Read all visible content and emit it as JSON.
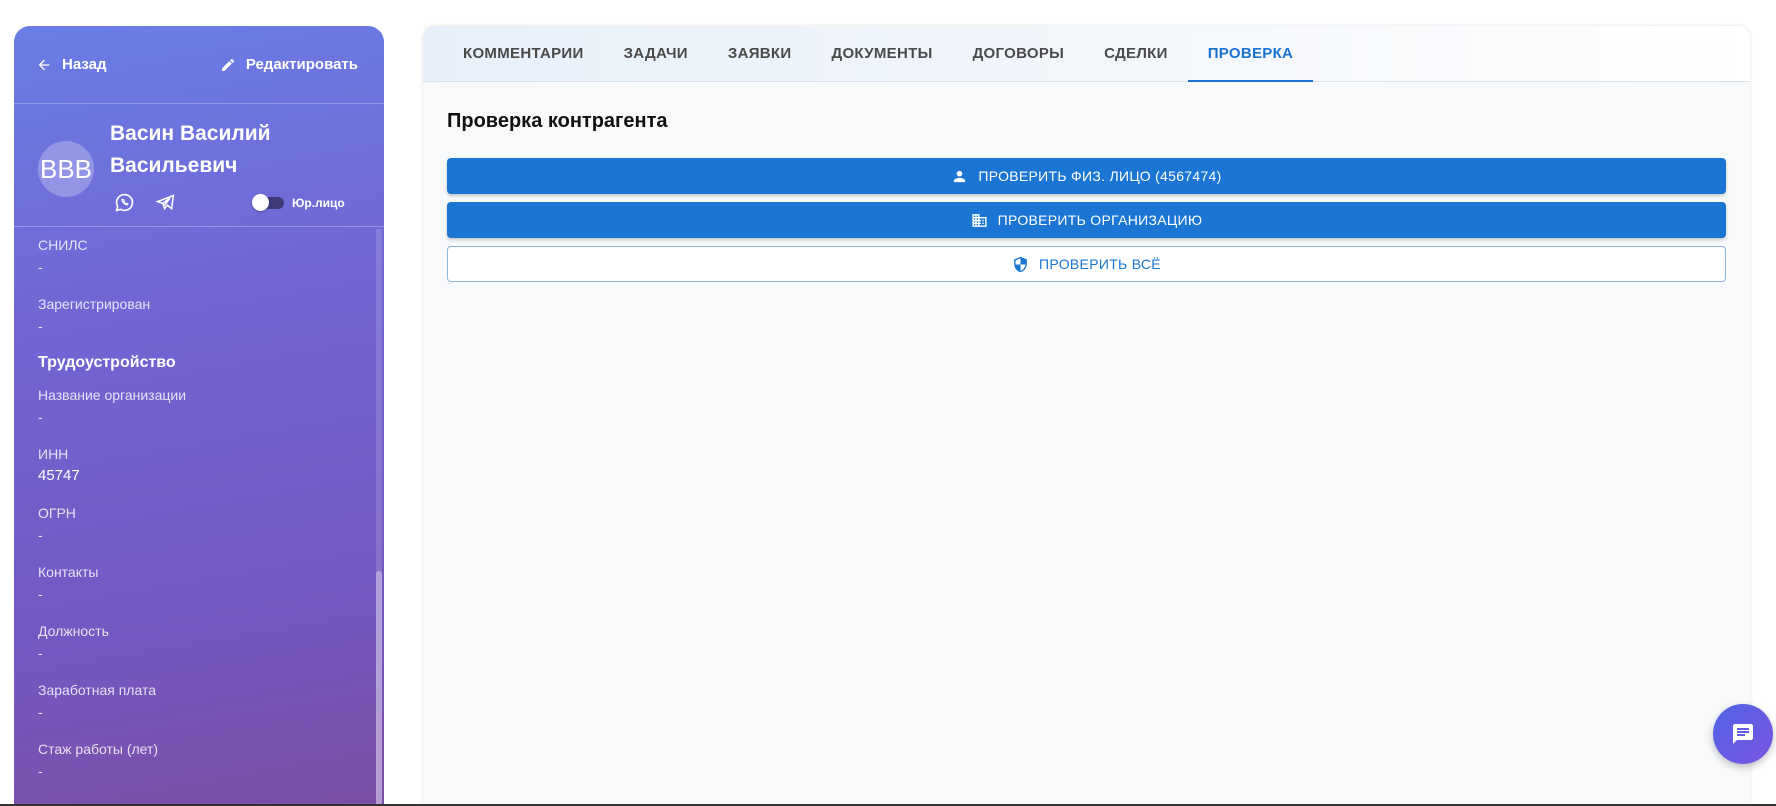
{
  "sidebar": {
    "back_label": "Назад",
    "edit_label": "Редактировать",
    "avatar_initials": "ВВВ",
    "name_line1": "Васин Василий",
    "name_line2": "Васильевич",
    "toggle_label": "Юр.лицо",
    "snils": {
      "label": "СНИЛС",
      "value": "-"
    },
    "registered": {
      "label": "Зарегистрирован",
      "value": "-"
    },
    "employment_title": "Трудоустройство",
    "employment": [
      {
        "label": "Название организации",
        "value": "-"
      },
      {
        "label": "ИНН",
        "value": "45747"
      },
      {
        "label": "ОГРН",
        "value": "-"
      },
      {
        "label": "Контакты",
        "value": "-"
      },
      {
        "label": "Должность",
        "value": "-"
      },
      {
        "label": "Заработная плата",
        "value": "-"
      },
      {
        "label": "Стаж работы (лет)",
        "value": "-"
      }
    ]
  },
  "tabs": [
    "КОММЕНТАРИИ",
    "ЗАДАЧИ",
    "ЗАЯВКИ",
    "ДОКУМЕНТЫ",
    "ДОГОВОРЫ",
    "СДЕЛКИ",
    "ПРОВЕРКА"
  ],
  "main": {
    "heading": "Проверка контрагента",
    "check_person_label": "ПРОВЕРИТЬ ФИЗ. ЛИЦО (4567474)",
    "check_org_label": "ПРОВЕРИТЬ ОРГАНИЗАЦИЮ",
    "check_all_label": "ПРОВЕРИТЬ ВСЁ"
  },
  "icons": {
    "back": "arrow-left-icon",
    "edit": "pencil-icon",
    "whatsapp": "whatsapp-icon",
    "telegram": "telegram-icon",
    "person": "person-icon",
    "building": "building-icon",
    "shield": "shield-icon",
    "chat": "chat-icon"
  },
  "colors": {
    "primary": "#1a76d2",
    "active_tab": "#1a73d1",
    "sidebar_gradient_start": "#6a7ee6",
    "sidebar_gradient_end": "#7a4fa6"
  }
}
